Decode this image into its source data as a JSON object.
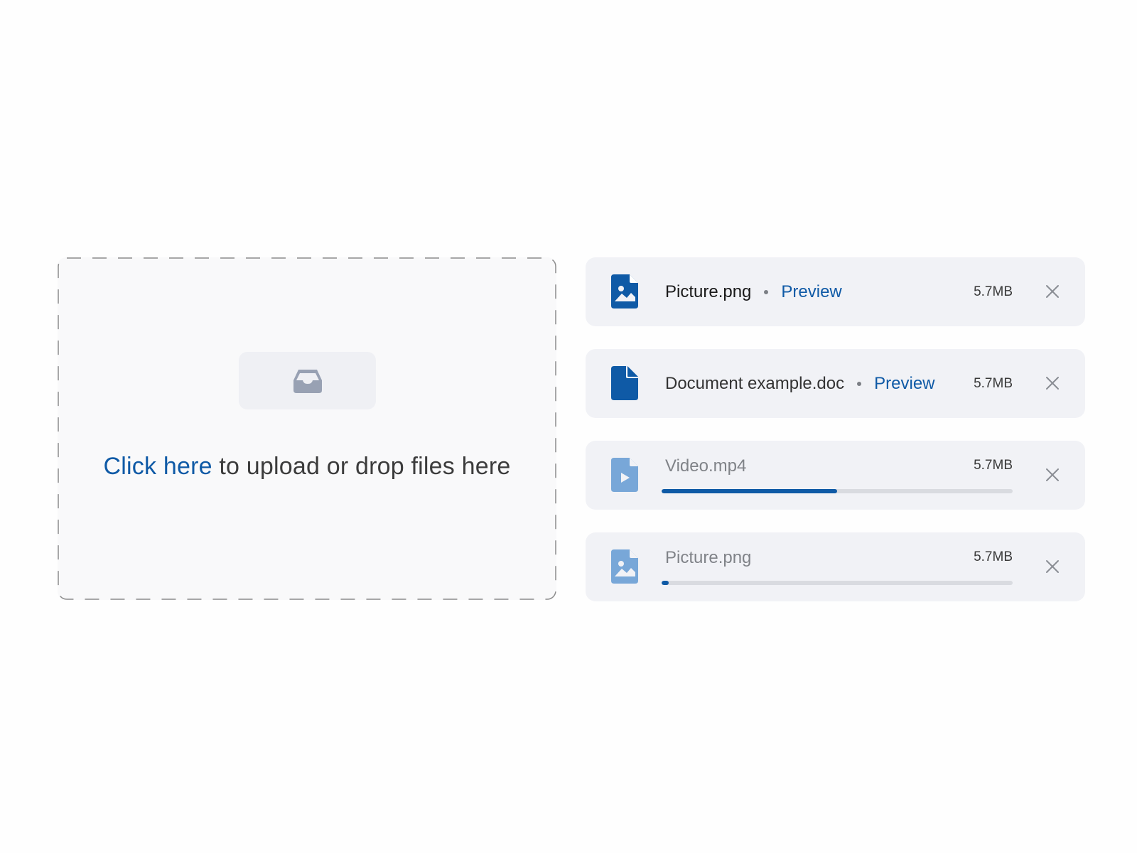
{
  "colors": {
    "accent": "#0f5aa6",
    "accent_light": "#78a7d8",
    "card_bg": "#f1f2f6",
    "dropzone_bg": "#f9f9fa",
    "muted_text": "#808388",
    "track": "#d9dbe0"
  },
  "dropzone": {
    "icon": "inbox-tray-icon",
    "link_label": "Click here",
    "text": " to upload or drop files here"
  },
  "files": [
    {
      "name": "Picture.png",
      "icon": "image-file-icon",
      "status": "uploaded",
      "preview_label": "Preview",
      "size": "5.7MB",
      "close_icon": "close-icon"
    },
    {
      "name": "Document example.doc",
      "icon": "document-file-icon",
      "status": "uploaded",
      "preview_label": "Preview",
      "size": "5.7MB",
      "close_icon": "close-icon"
    },
    {
      "name": "Video.mp4",
      "icon": "video-file-icon",
      "status": "uploading",
      "progress": 0.5,
      "size": "5.7MB",
      "close_icon": "close-icon"
    },
    {
      "name": "Picture.png",
      "icon": "image-file-icon",
      "status": "uploading",
      "progress": 0.02,
      "size": "5.7MB",
      "close_icon": "close-icon"
    }
  ]
}
